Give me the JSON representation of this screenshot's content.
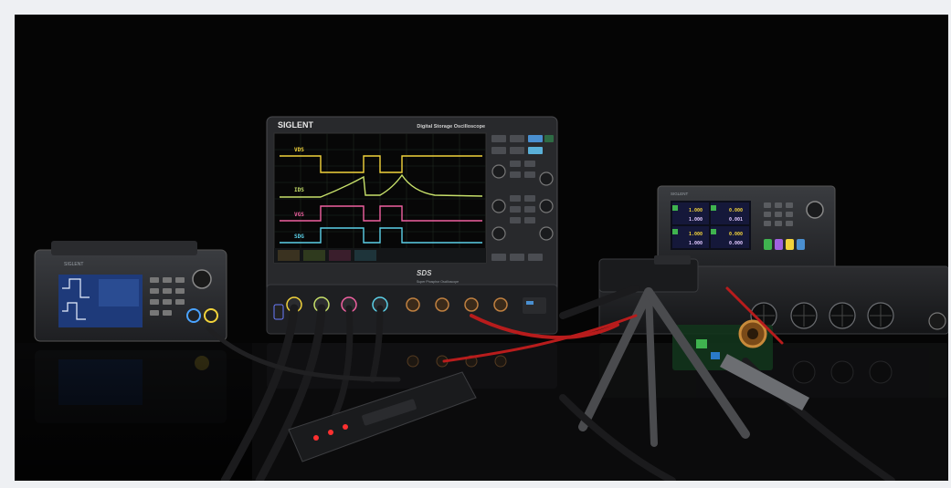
{
  "scene": {
    "brand": "SIGLENT",
    "oscilloscope": {
      "title": "Digital Storage Oscilloscope",
      "model_mark": "SDS",
      "subtitle": "Super Phosphor Oscilloscope",
      "channel_labels": [
        "VDS",
        "IDS",
        "VGS",
        "SDG"
      ],
      "trace_colors": [
        "#f2d33b",
        "#c7e06a",
        "#f060a0",
        "#5bd0e8"
      ]
    },
    "power_supply": {
      "brand": "SIGLENT",
      "readouts": [
        "1.000",
        "0.000",
        "1.000",
        "0.001",
        "1.000",
        "0.000",
        "1.000",
        "0.000"
      ]
    },
    "signal_generator": {
      "brand": "SIGLENT"
    }
  }
}
